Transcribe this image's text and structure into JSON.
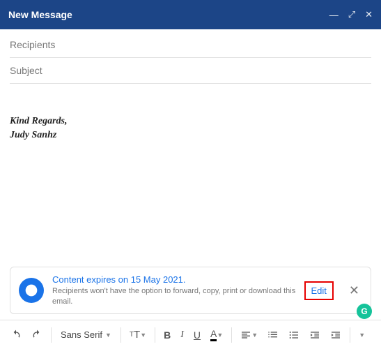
{
  "header": {
    "title": "New Message"
  },
  "fields": {
    "recipients_placeholder": "Recipients",
    "subject_placeholder": "Subject"
  },
  "body": {
    "signature_line1": "Kind Regards,",
    "signature_line2": "Judy Sanhz"
  },
  "confidential": {
    "title": "Content expires on 15 May 2021.",
    "subtitle": "Recipients won't have the option to forward, copy, print or download this email.",
    "edit_label": "Edit"
  },
  "toolbar": {
    "font_name": "Sans Serif",
    "size_label": "T",
    "bold": "B",
    "italic": "I",
    "underline": "U",
    "color": "A"
  },
  "grammarly_glyph": "G"
}
